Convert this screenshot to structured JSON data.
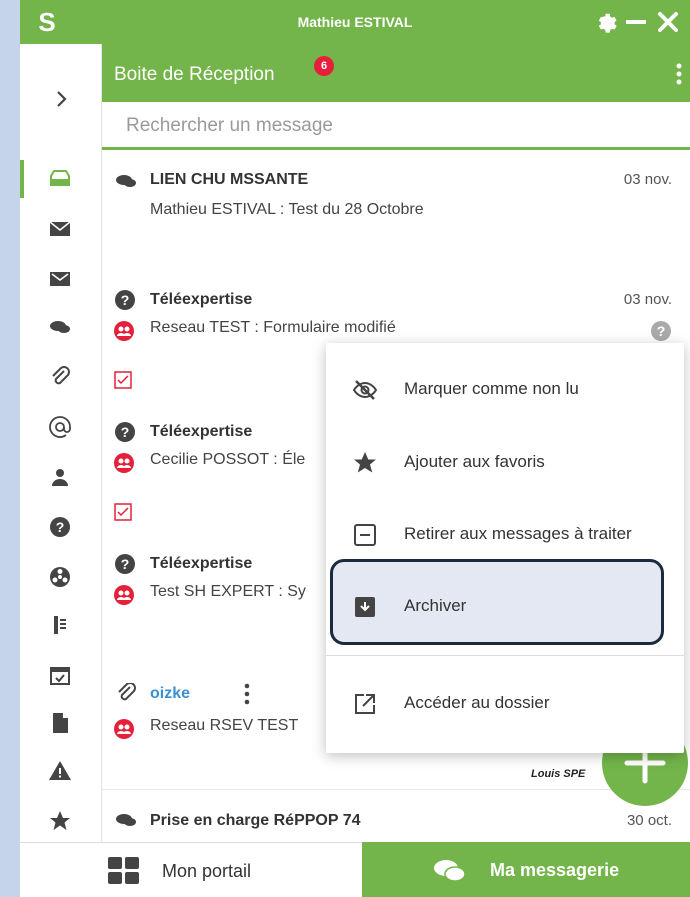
{
  "window": {
    "title": "Mathieu ESTIVAL",
    "logo_letter": "S"
  },
  "inbox": {
    "title": "Boite de Réception",
    "badge": "6"
  },
  "search": {
    "placeholder": "Rechercher un message"
  },
  "messages": [
    {
      "type_icon": "chat-icon",
      "title": "LIEN CHU MSSANTE",
      "date": "03 nov.",
      "subject": "Mathieu ESTIVAL : Test du 28 Octobre"
    },
    {
      "type_icon": "help-icon",
      "title": "Téléexpertise",
      "date": "03 nov.",
      "subject": "Reseau TEST : Formulaire modifié"
    },
    {
      "type_icon": "help-icon",
      "title": "Téléexpertise",
      "subject": "Cecilie POSSOT : Éle"
    },
    {
      "type_icon": "help-icon",
      "title": "Téléexpertise",
      "subject": "Test SH EXPERT : Sy"
    },
    {
      "type_icon": "paperclip-icon",
      "title": "oizke",
      "subject": "Reseau RSEV TEST"
    },
    {
      "type_icon": "chat-icon",
      "title": "Prise en charge RéPPOP 74",
      "date": "30 oct."
    }
  ],
  "sender_signature": "Louis SPE",
  "context_menu": {
    "items": [
      {
        "label": "Marquer comme non lu",
        "icon": "eye-slash-icon"
      },
      {
        "label": "Ajouter aux favoris",
        "icon": "star-icon"
      },
      {
        "label": "Retirer aux messages à traiter",
        "icon": "minus-square-icon"
      },
      {
        "label": "Archiver",
        "icon": "archive-icon"
      },
      {
        "label": "Accéder au dossier",
        "icon": "external-link-icon"
      }
    ]
  },
  "bottom_nav": {
    "portail": "Mon portail",
    "messagerie": "Ma messagerie"
  },
  "colors": {
    "brand_green": "#73b54a",
    "badge_red": "#e5203a",
    "link_blue": "#3a8fd6"
  }
}
